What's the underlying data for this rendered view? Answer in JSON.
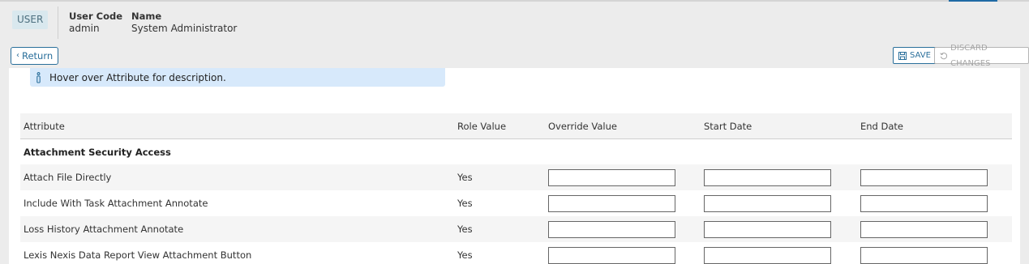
{
  "header": {
    "badge": "USER",
    "user_code_label": "User Code",
    "user_code_value": "admin",
    "name_label": "Name",
    "name_value": "System Administrator"
  },
  "toolbar": {
    "return_label": "Return",
    "save_label": "SAVE",
    "discard_label": "DISCARD CHANGES"
  },
  "info": {
    "message": "Hover over Attribute for description."
  },
  "table": {
    "columns": [
      "Attribute",
      "Role Value",
      "Override Value",
      "Start Date",
      "End Date"
    ],
    "group": "Attachment Security Access",
    "rows": [
      {
        "attribute": "Attach File Directly",
        "role_value": "Yes",
        "override": "",
        "start": "",
        "end": ""
      },
      {
        "attribute": "Include With Task Attachment Annotate",
        "role_value": "Yes",
        "override": "",
        "start": "",
        "end": ""
      },
      {
        "attribute": "Loss History Attachment Annotate",
        "role_value": "Yes",
        "override": "",
        "start": "",
        "end": ""
      },
      {
        "attribute": "Lexis Nexis Data Report View Attachment Button",
        "role_value": "Yes",
        "override": "",
        "start": "",
        "end": ""
      }
    ]
  },
  "colors": {
    "accent": "#2a6f9b",
    "banner": "#d7e9fb",
    "badge_bg": "#d9e8ee"
  }
}
